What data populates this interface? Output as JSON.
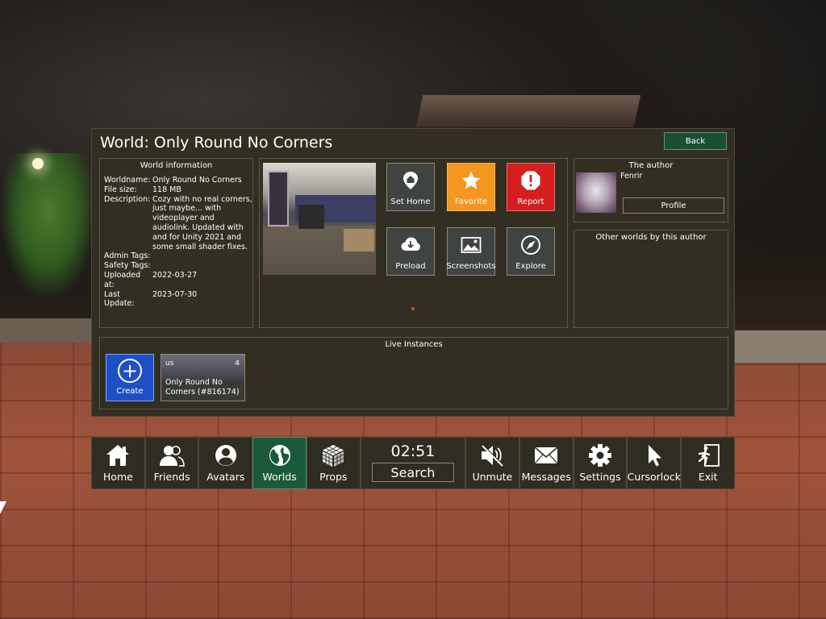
{
  "panel": {
    "title": "World: Only Round No Corners",
    "back_label": "Back"
  },
  "world_info": {
    "heading": "World information",
    "rows": [
      {
        "label": "Worldname:",
        "value": "Only Round No Corners"
      },
      {
        "label": "File size:",
        "value": "118 MB"
      },
      {
        "label": "Description:",
        "value": "Cozy with no real corners, just maybe... with videoplayer and audiolink. Updated with and for Unity 2021 and some small shader fixes."
      },
      {
        "label": "Admin Tags:",
        "value": ""
      },
      {
        "label": "Safety Tags:",
        "value": ""
      },
      {
        "label": "Uploaded at:",
        "value": "2022-03-27"
      },
      {
        "label": "Last Update:",
        "value": "2023-07-30"
      }
    ]
  },
  "actions": {
    "set_home": "Set Home",
    "favorite": "Favorite",
    "report": "Report",
    "preload": "Preload",
    "screenshots": "Screenshots",
    "explore": "Explore"
  },
  "author": {
    "heading": "The author",
    "name": "Fenrir",
    "profile_label": "Profile",
    "other_worlds_heading": "Other worlds by this author"
  },
  "instances": {
    "heading": "Live Instances",
    "create_label": "Create",
    "items": [
      {
        "region": "us",
        "count": "4",
        "name": "Only Round No Corners (#816174)"
      }
    ]
  },
  "dock": {
    "clock": "02:51",
    "search_label": "Search",
    "items": [
      {
        "label": "Home",
        "icon": "home-icon"
      },
      {
        "label": "Friends",
        "icon": "friends-icon"
      },
      {
        "label": "Avatars",
        "icon": "avatar-icon"
      },
      {
        "label": "Worlds",
        "icon": "globe-icon"
      },
      {
        "label": "Props",
        "icon": "cube-icon"
      },
      {
        "label": "Unmute",
        "icon": "speaker-muted-icon"
      },
      {
        "label": "Messages",
        "icon": "envelope-icon"
      },
      {
        "label": "Settings",
        "icon": "gear-icon"
      },
      {
        "label": "Cursorlock",
        "icon": "cursor-icon"
      },
      {
        "label": "Exit",
        "icon": "exit-icon"
      }
    ],
    "active": "Worlds"
  },
  "colors": {
    "panel_bg": "#322f22",
    "active_tab": "#1a5a3a",
    "favorite": "#f5961e",
    "report": "#d51f1f",
    "create": "#1f4fc6"
  }
}
